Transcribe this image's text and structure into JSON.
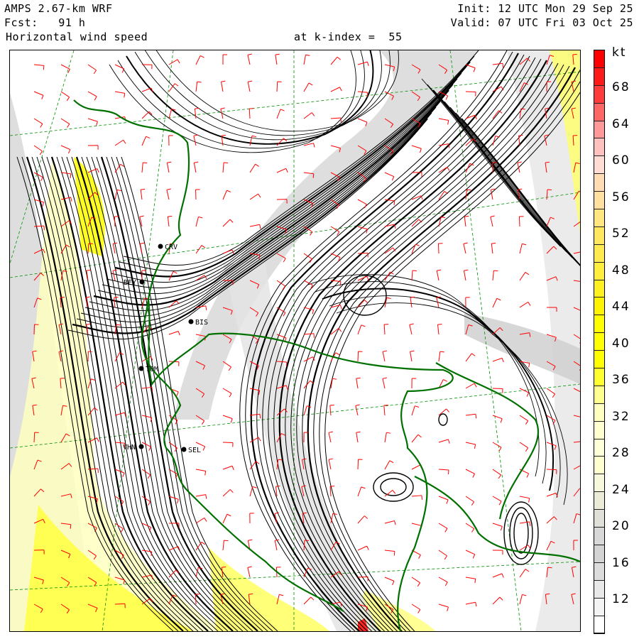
{
  "header": {
    "model": "AMPS 2.67-km WRF",
    "forecast": "Fcst:   91 h",
    "field": "Horizontal wind speed",
    "level": "at k-index =  55",
    "init": "Init: 12 UTC Mon 29 Sep 25",
    "valid": "Valid: 07 UTC Fri 03 Oct 25"
  },
  "colorbar": {
    "unit": "kt",
    "labels": [
      "68",
      "64",
      "60",
      "56",
      "52",
      "48",
      "44",
      "40",
      "36",
      "32",
      "28",
      "24",
      "20",
      "16",
      "12"
    ],
    "colors": [
      "#ff0000",
      "#ff1a1a",
      "#ff3c3c",
      "#ff6666",
      "#ff9999",
      "#ffc0c0",
      "#ffdcd4",
      "#ffdcb4",
      "#ffe0a0",
      "#ffe680",
      "#ffe860",
      "#ffea50",
      "#ffee3c",
      "#fff020",
      "#fff400",
      "#ffff00",
      "#ffff00",
      "#ffff00",
      "#ffff30",
      "#ffff90",
      "#ffffc0",
      "#ffffd0",
      "#ffffd8",
      "#ffffd0",
      "#f8f8dc",
      "#ebebd8",
      "#e0e0d8",
      "#d8d8d8",
      "#d4d4d4",
      "#dcdcdc",
      "#e8e8e8",
      "#f4f4f4",
      "#ffffff"
    ]
  },
  "stations": [
    "CRV",
    "BEY",
    "BIS",
    "TOM",
    "VHN",
    "SEL"
  ],
  "colors": {
    "coast": "#007000",
    "barb": "#ff0000",
    "grid": "#009000"
  }
}
